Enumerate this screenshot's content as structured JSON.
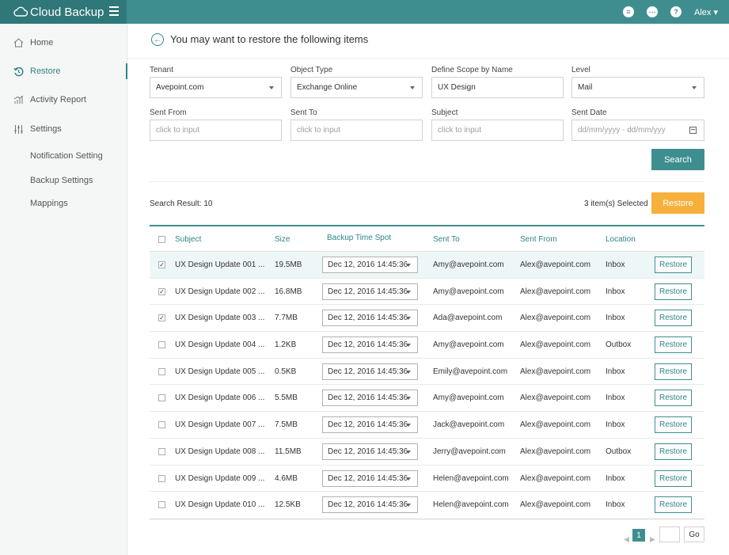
{
  "app": {
    "title": "Cloud Backup",
    "user": "Alex ▾"
  },
  "topbar": {
    "icons": [
      "list-icon",
      "chat-icon",
      "help-icon"
    ]
  },
  "sidebar": {
    "items": [
      {
        "label": "Home",
        "icon": "home-icon"
      },
      {
        "label": "Restore",
        "icon": "restore-icon",
        "active": true
      },
      {
        "label": "Activity Report",
        "icon": "chart-icon"
      },
      {
        "label": "Settings",
        "icon": "sliders-icon"
      }
    ],
    "sub_items": [
      "Notification Setting",
      "Backup Settings",
      "Mappings"
    ]
  },
  "page": {
    "title": "You may want to restore the following items"
  },
  "filters": {
    "tenant": {
      "label": "Tenant",
      "value": "Avepoint.com"
    },
    "object_type": {
      "label": "Object Type",
      "value": "Exchange Online"
    },
    "scope": {
      "label": "Define Scope by Name",
      "value": "UX Design"
    },
    "level": {
      "label": "Level",
      "value": "Mail"
    },
    "sent_from": {
      "label": "Sent From",
      "placeholder": "click to input"
    },
    "sent_to": {
      "label": "Sent To",
      "placeholder": "click to input"
    },
    "subject": {
      "label": "Subject",
      "placeholder": "click to input"
    },
    "sent_date": {
      "label": "Sent Date",
      "placeholder": "dd/mm/yyyy - dd/mm/yyy"
    },
    "search_label": "Search"
  },
  "results": {
    "summary": "Search Result: 10",
    "selected": "3 item(s) Selected",
    "restore_label": "Restore"
  },
  "table": {
    "columns": [
      "Subject",
      "Size",
      "Backup Time Spot",
      "Sent To",
      "Sent From",
      "Location"
    ],
    "rows": [
      {
        "checked": true,
        "subject": "UX Design Update 001 ...",
        "size": "19.5MB",
        "time": "Dec 12, 2016 14:45:36",
        "to": "Amy@avepoint.com",
        "from": "Alex@avepoint.com",
        "location": "Inbox",
        "action": "Restore"
      },
      {
        "checked": true,
        "subject": "UX Design Update 002 ...",
        "size": "16.8MB",
        "time": "Dec 12, 2016 14:45:36",
        "to": "Amy@avepoint.com",
        "from": "Alex@avepoint.com",
        "location": "Inbox",
        "action": "Restore"
      },
      {
        "checked": true,
        "subject": "UX Design Update 003 ...",
        "size": "7.7MB",
        "time": "Dec 12, 2016 14:45:36",
        "to": "Ada@avepoint.com",
        "from": "Alex@avepoint.com",
        "location": "Inbox",
        "action": "Restore"
      },
      {
        "checked": false,
        "subject": "UX Design Update 004 ...",
        "size": "1.2KB",
        "time": "Dec 12, 2016 14:45:36",
        "to": "Amy@avepoint.com",
        "from": "Alex@avepoint.com",
        "location": "Outbox",
        "action": "Restore"
      },
      {
        "checked": false,
        "subject": "UX Design Update 005 ...",
        "size": "0.5KB",
        "time": "Dec 12, 2016 14:45:36",
        "to": "Emily@avepoint.com",
        "from": "Alex@avepoint.com",
        "location": "Inbox",
        "action": "Restore"
      },
      {
        "checked": false,
        "subject": "UX Design Update 006 ...",
        "size": "5.5MB",
        "time": "Dec 12, 2016 14:45:36",
        "to": "Amy@avepoint.com",
        "from": "Alex@avepoint.com",
        "location": "Inbox",
        "action": "Restore"
      },
      {
        "checked": false,
        "subject": "UX Design Update 007 ...",
        "size": "7.5MB",
        "time": "Dec 12, 2016 14:45:36",
        "to": "Jack@avepoint.com",
        "from": "Alex@avepoint.com",
        "location": "Inbox",
        "action": "Restore"
      },
      {
        "checked": false,
        "subject": "UX Design Update 008 ...",
        "size": "11.5MB",
        "time": "Dec 12, 2016 14:45:36",
        "to": "Jerry@avepoint.com",
        "from": "Alex@avepoint.com",
        "location": "Outbox",
        "action": "Restore"
      },
      {
        "checked": false,
        "subject": "UX Design Update 009 ...",
        "size": "4.6MB",
        "time": "Dec 12, 2016 14:45:36",
        "to": "Helen@avepoint.com",
        "from": "Alex@avepoint.com",
        "location": "Inbox",
        "action": "Restore"
      },
      {
        "checked": false,
        "subject": "UX Design Update 010 ...",
        "size": "12.5KB",
        "time": "Dec 12, 2016 14:45:36",
        "to": "Helen@avepoint.com",
        "from": "Alex@avepoint.com",
        "location": "Inbox",
        "action": "Restore"
      }
    ]
  },
  "pagination": {
    "current": "1",
    "go_label": "Go"
  },
  "colors": {
    "teal": "#3f8e8f",
    "teal_dark": "#2f7778",
    "orange": "#f7b03c"
  }
}
